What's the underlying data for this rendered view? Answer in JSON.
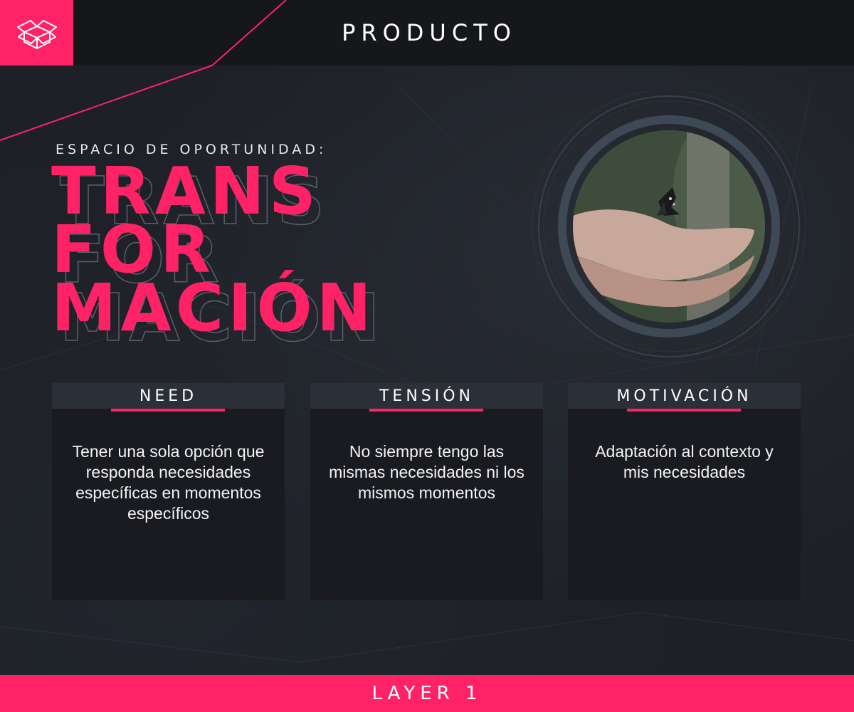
{
  "header": {
    "title": "PRODUCTO",
    "logo_icon": "open-box-icon"
  },
  "hero": {
    "subtitle": "ESPACIO DE OPORTUNIDAD:",
    "word_lines": [
      "TRANS",
      "FOR",
      "MACIÓN"
    ],
    "image": "hands-holding-butterfly-photo"
  },
  "cards": [
    {
      "title": "NEED",
      "text": "Tener una sola opción que responda necesidades específicas en momentos específicos"
    },
    {
      "title": "TENSIÓN",
      "text": "No siempre tengo las mismas necesidades ni los mismos momentos"
    },
    {
      "title": "MOTIVACIÓN",
      "text": "Adaptación al contexto y mis necesidades"
    }
  ],
  "footer": {
    "label": "LAYER 1"
  },
  "colors": {
    "accent": "#ff2266",
    "background": "#1d2026",
    "card": "#191b20",
    "card_header": "#2b2f37"
  }
}
